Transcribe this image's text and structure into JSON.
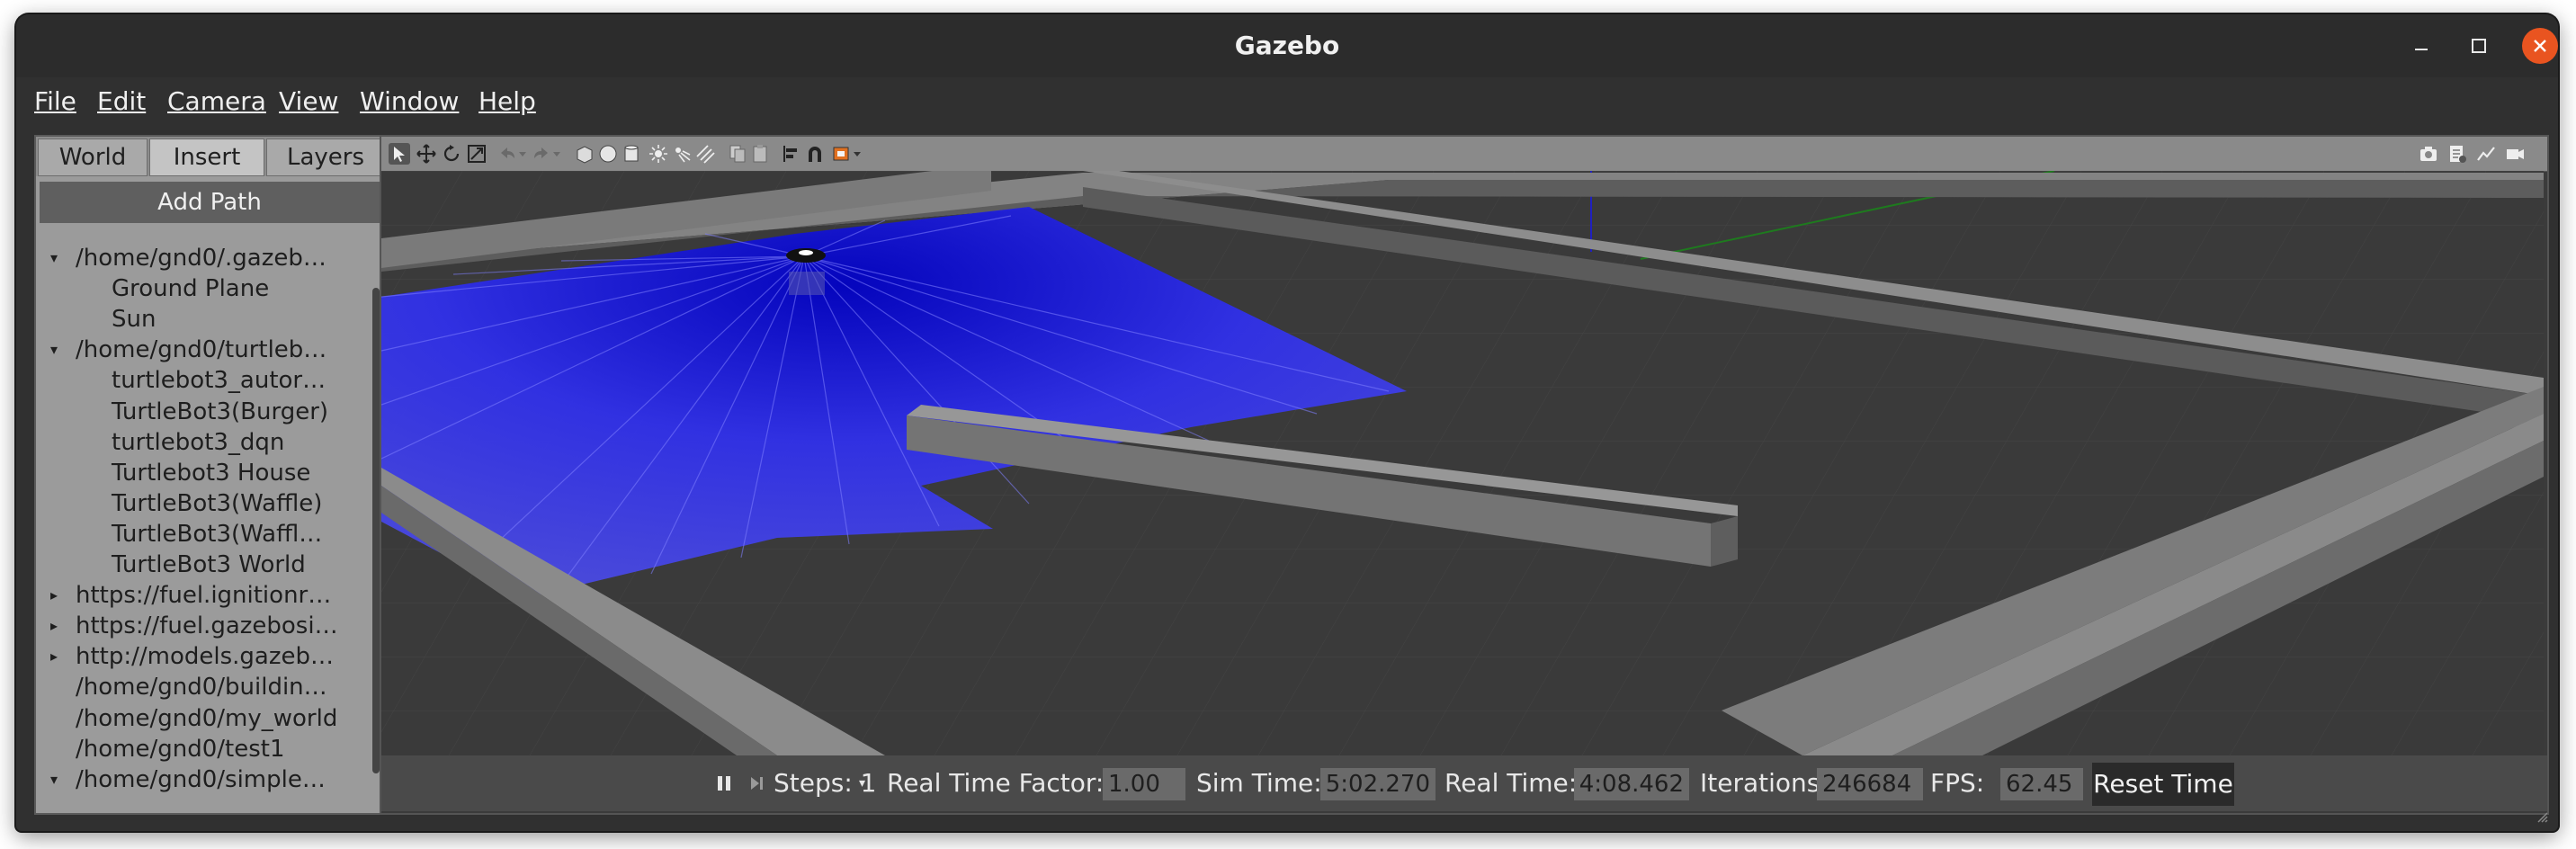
{
  "window": {
    "title": "Gazebo"
  },
  "menu": [
    "File",
    "Edit",
    "Camera",
    "View",
    "Window",
    "Help"
  ],
  "tabs": [
    "World",
    "Insert",
    "Layers"
  ],
  "add_path_label": "Add Path",
  "tree": [
    {
      "label": "/home/gnd0/.gazeb…",
      "level": 0,
      "arrow": "▾"
    },
    {
      "label": "Ground Plane",
      "level": 1
    },
    {
      "label": "Sun",
      "level": 1
    },
    {
      "label": "/home/gnd0/turtleb…",
      "level": 0,
      "arrow": "▾"
    },
    {
      "label": "turtlebot3_autor…",
      "level": 1
    },
    {
      "label": "TurtleBot3(Burger)",
      "level": 1
    },
    {
      "label": "turtlebot3_dqn",
      "level": 1
    },
    {
      "label": "Turtlebot3 House",
      "level": 1
    },
    {
      "label": "TurtleBot3(Waffle)",
      "level": 1
    },
    {
      "label": "TurtleBot3(Waffl…",
      "level": 1
    },
    {
      "label": "TurtleBot3 World",
      "level": 1
    },
    {
      "label": "https://fuel.ignitionr…",
      "level": 0,
      "arrow": "▸"
    },
    {
      "label": "https://fuel.gazebosi…",
      "level": 0,
      "arrow": "▸"
    },
    {
      "label": "http://models.gazeb…",
      "level": 0,
      "arrow": "▸"
    },
    {
      "label": "/home/gnd0/buildin…",
      "level": 0
    },
    {
      "label": "/home/gnd0/my_world",
      "level": 0
    },
    {
      "label": "/home/gnd0/test1",
      "level": 0
    },
    {
      "label": "/home/gnd0/simple…",
      "level": 0,
      "arrow": "▾"
    }
  ],
  "status": {
    "steps_label": "Steps: 1",
    "rtf_label": "Real Time Factor:",
    "rtf_value": "1.00",
    "sim_label": "Sim Time:",
    "sim_value": "5:02.270",
    "real_label": "Real Time:",
    "real_value": "4:08.462",
    "iter_label": "Iterations:",
    "iter_value": "246684",
    "fps_label": "FPS:",
    "fps_value": "62.45",
    "reset_label": "Reset Time"
  },
  "colors": {
    "laser": "#1a1aff",
    "walls": "#8c8c8c",
    "floor": "#3a3a3a",
    "close_button": "#e95420"
  },
  "icons": {
    "toolbar_left": [
      "select-arrow-icon",
      "translate-icon",
      "rotate-icon",
      "scale-icon",
      "undo-icon",
      "redo-icon",
      "box-shape-icon",
      "sphere-shape-icon",
      "cylinder-shape-icon",
      "point-light-icon",
      "spot-light-icon",
      "directional-light-icon",
      "copy-icon",
      "paste-icon",
      "align-icon",
      "snap-icon",
      "view-angle-icon"
    ],
    "toolbar_right": [
      "screenshot-icon",
      "log-icon",
      "plot-icon",
      "video-icon"
    ]
  }
}
